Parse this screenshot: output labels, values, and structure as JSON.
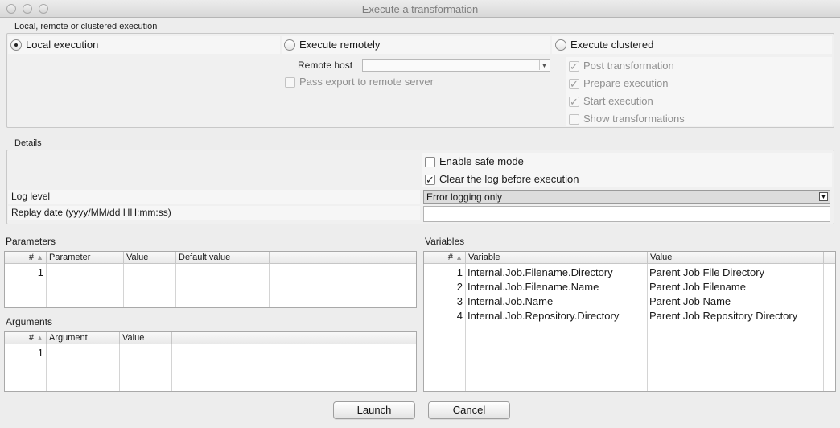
{
  "window": {
    "title": "Execute a transformation"
  },
  "execution": {
    "group_label": "Local, remote or clustered execution",
    "local_label": "Local execution",
    "local_selected": true,
    "remote_label": "Execute remotely",
    "clustered_label": "Execute clustered",
    "remote_host_label": "Remote host",
    "remote_host_value": "",
    "pass_export_label": "Pass export to remote server",
    "post_transformation_label": "Post transformation",
    "prepare_execution_label": "Prepare execution",
    "start_execution_label": "Start execution",
    "show_transformations_label": "Show transformations"
  },
  "details": {
    "group_label": "Details",
    "safe_mode_label": "Enable safe mode",
    "safe_mode_checked": false,
    "clear_log_label": "Clear the log before execution",
    "clear_log_checked": true,
    "log_level_label": "Log level",
    "log_level_value": "Error logging only",
    "replay_date_label": "Replay date (yyyy/MM/dd HH:mm:ss)",
    "replay_date_value": ""
  },
  "parameters": {
    "title": "Parameters",
    "columns": [
      "#",
      "Parameter",
      "Value",
      "Default value"
    ],
    "rows": [
      {
        "num": "1",
        "parameter": "",
        "value": "",
        "default": ""
      }
    ]
  },
  "arguments": {
    "title": "Arguments",
    "columns": [
      "#",
      "Argument",
      "Value"
    ],
    "rows": [
      {
        "num": "1",
        "argument": "",
        "value": ""
      }
    ]
  },
  "variables": {
    "title": "Variables",
    "columns": [
      "#",
      "Variable",
      "Value"
    ],
    "rows": [
      {
        "num": "1",
        "variable": "Internal.Job.Filename.Directory",
        "value": "Parent Job File Directory"
      },
      {
        "num": "2",
        "variable": "Internal.Job.Filename.Name",
        "value": "Parent Job Filename"
      },
      {
        "num": "3",
        "variable": "Internal.Job.Name",
        "value": "Parent Job Name"
      },
      {
        "num": "4",
        "variable": "Internal.Job.Repository.Directory",
        "value": "Parent Job Repository Directory"
      }
    ]
  },
  "buttons": {
    "launch": "Launch",
    "cancel": "Cancel"
  },
  "sort_icon": "▲",
  "dropdown_icon": "▼"
}
